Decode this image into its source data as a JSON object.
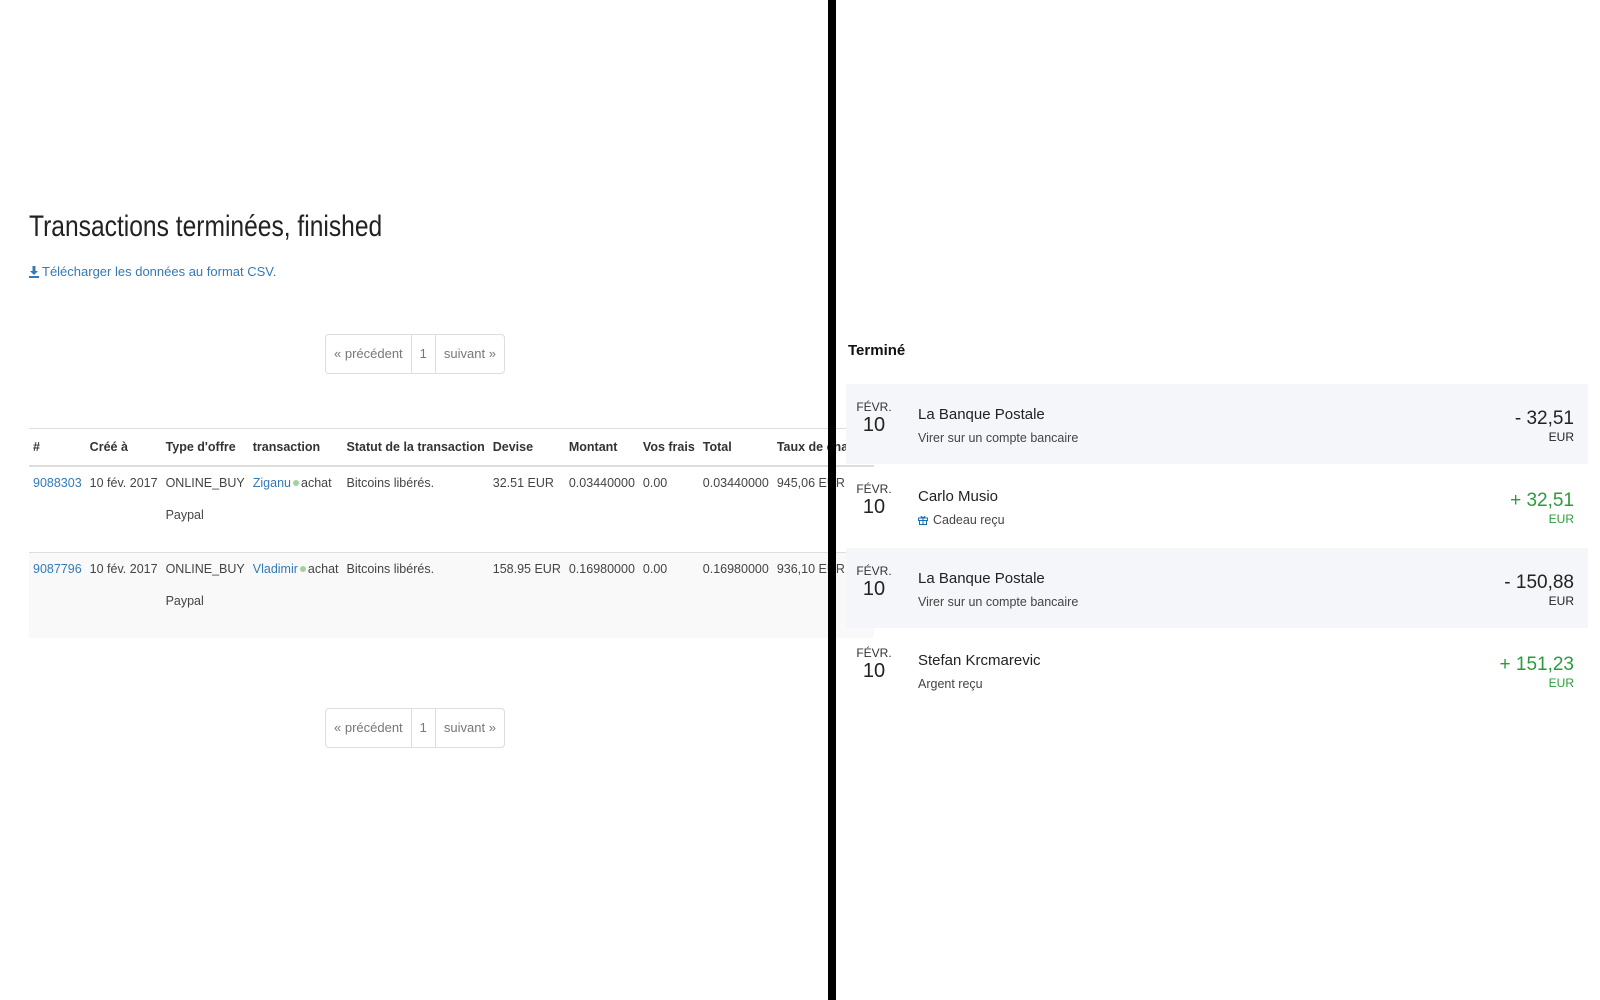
{
  "left": {
    "title": "Transactions terminées, finished",
    "csv_link": "Télécharger les données au format CSV.",
    "pagination": {
      "prev": "« précédent",
      "current": "1",
      "next": "suivant »"
    },
    "table": {
      "headers": [
        "#",
        "Créé à",
        "Type d'offre",
        "transaction",
        "Statut de la transaction",
        "Devise",
        "Montant",
        "Vos frais",
        "Total",
        "Taux de change"
      ],
      "rows": [
        {
          "id": "9088303",
          "created": "10 fév. 2017",
          "offer_type": "ONLINE_BUY",
          "offer_method": "Paypal",
          "trader": "Ziganu",
          "action": "achat",
          "status": "Bitcoins libérés.",
          "currency": "32.51 EUR",
          "amount": "0.03440000",
          "fees": "0.00",
          "total": "0.03440000",
          "rate": "945,06 EUR"
        },
        {
          "id": "9087796",
          "created": "10 fév. 2017",
          "offer_type": "ONLINE_BUY",
          "offer_method": "Paypal",
          "trader": "Vladimir",
          "action": "achat",
          "status": "Bitcoins libérés.",
          "currency": "158.95 EUR",
          "amount": "0.16980000",
          "fees": "0.00",
          "total": "0.16980000",
          "rate": "936,10 EUR"
        }
      ]
    }
  },
  "right": {
    "title": "Terminé",
    "items": [
      {
        "month": "FÉVR.",
        "day": "10",
        "name": "La Banque Postale",
        "sub": "Virer sur un compte bancaire",
        "amount": "- 32,51",
        "currency": "EUR",
        "sign": "neg",
        "icon": ""
      },
      {
        "month": "FÉVR.",
        "day": "10",
        "name": "Carlo Musio",
        "sub": "Cadeau reçu",
        "amount": "+ 32,51",
        "currency": "EUR",
        "sign": "pos",
        "icon": "gift-icon"
      },
      {
        "month": "FÉVR.",
        "day": "10",
        "name": "La Banque Postale",
        "sub": "Virer sur un compte bancaire",
        "amount": "- 150,88",
        "currency": "EUR",
        "sign": "neg",
        "icon": ""
      },
      {
        "month": "FÉVR.",
        "day": "10",
        "name": "Stefan Krcmarevic",
        "sub": "Argent reçu",
        "amount": "+ 151,23",
        "currency": "EUR",
        "sign": "pos",
        "icon": ""
      }
    ],
    "colors": {
      "positive": "#2a9c3a",
      "negative": "#222222",
      "row_shade": "#f4f6f9"
    }
  }
}
